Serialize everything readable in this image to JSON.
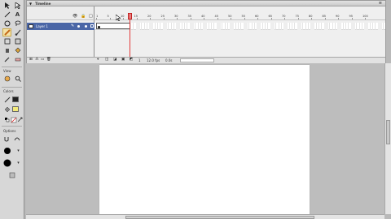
{
  "timeline": {
    "header_title": "Timeline",
    "header_arrow": "▼",
    "options_glyph": "≡",
    "layer": {
      "name": "Layer 1",
      "pencil": "✎"
    },
    "ruler_labels": [
      "1",
      "5",
      "10",
      "15",
      "20",
      "25",
      "30",
      "35",
      "40",
      "45",
      "50",
      "55",
      "60",
      "65",
      "70",
      "75",
      "80",
      "85",
      "90",
      "95",
      "100"
    ],
    "status": {
      "current_frame": "1",
      "frame_rate": "12.0 fps",
      "elapsed_time": "0.0s"
    }
  },
  "tools": {
    "view_label": "View",
    "colors_label": "Colors",
    "options_label": "Options",
    "stroke_color": "#222222",
    "fill_color": "#f2e97a"
  },
  "colors": {
    "selected_layer": "#4a66a6",
    "playhead": "#e23a3a",
    "stage_bg": "#bdbdbd",
    "canvas": "#ffffff"
  }
}
